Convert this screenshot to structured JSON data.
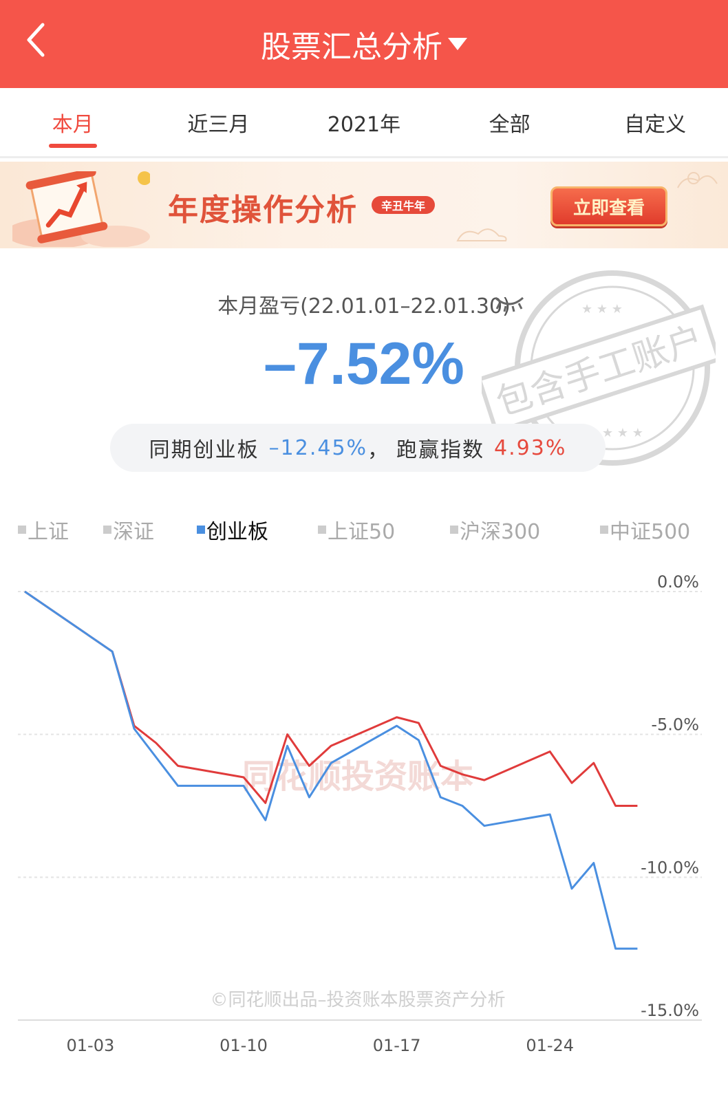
{
  "header": {
    "title": "股票汇总分析"
  },
  "tabs": [
    {
      "label": "本月",
      "active": true
    },
    {
      "label": "近三月"
    },
    {
      "label": "2021年"
    },
    {
      "label": "全部"
    },
    {
      "label": "自定义"
    }
  ],
  "banner": {
    "title": "年度操作分析",
    "badge": "辛丑牛年",
    "button": "立即查看"
  },
  "summary": {
    "label": "本月盈亏(22.01.01–22.01.30)",
    "value": "–7.52%",
    "compare_prefix": "同期创业板",
    "compare_index_value": "–12.45%",
    "compare_sep": "，",
    "compare_beat_label": "跑赢指数",
    "compare_beat_value": "4.93%",
    "stamp_text": "包含手工账户"
  },
  "legend": [
    {
      "label": "上证",
      "active": false
    },
    {
      "label": "深证",
      "active": false
    },
    {
      "label": "创业板",
      "active": true
    },
    {
      "label": "上证50",
      "active": false
    },
    {
      "label": "沪深300",
      "active": false
    },
    {
      "label": "中证500",
      "active": false
    }
  ],
  "colors": {
    "brand": "#f5554a",
    "account_line": "#e03b3b",
    "index_line": "#4a8fe0"
  },
  "chart_data": {
    "type": "line",
    "watermark": "同花顺投资账本",
    "footer": "©同花顺出品–投资账本股票资产分析",
    "ylim": [
      -15,
      0
    ],
    "yticks": [
      "0.0%",
      "-5.0%",
      "-10.0%",
      "-15.0%"
    ],
    "ytick_values": [
      0,
      -5,
      -10,
      -15
    ],
    "xticks": [
      "01-03",
      "01-10",
      "01-17",
      "01-24"
    ],
    "xtick_index": [
      3,
      10,
      17,
      24
    ],
    "x_index": [
      0,
      4,
      5,
      6,
      7,
      10,
      11,
      12,
      13,
      14,
      17,
      18,
      19,
      20,
      21,
      24,
      25,
      26,
      27,
      28
    ],
    "series": [
      {
        "color": "#e03b3b",
        "values": [
          0,
          -2.1,
          -4.7,
          -5.3,
          -6.1,
          -6.5,
          -7.4,
          -5.0,
          -6.1,
          -5.4,
          -4.4,
          -4.6,
          -6.1,
          -6.4,
          -6.6,
          -5.6,
          -6.7,
          -6.0,
          -7.5,
          -7.5
        ]
      },
      {
        "color": "#4a8fe0",
        "values": [
          0,
          -2.1,
          -4.8,
          -5.8,
          -6.8,
          -6.8,
          -8.0,
          -5.4,
          -7.2,
          -6.0,
          -4.7,
          -5.2,
          -7.2,
          -7.5,
          -8.2,
          -7.8,
          -10.4,
          -9.5,
          -12.5,
          -12.5
        ]
      }
    ]
  }
}
